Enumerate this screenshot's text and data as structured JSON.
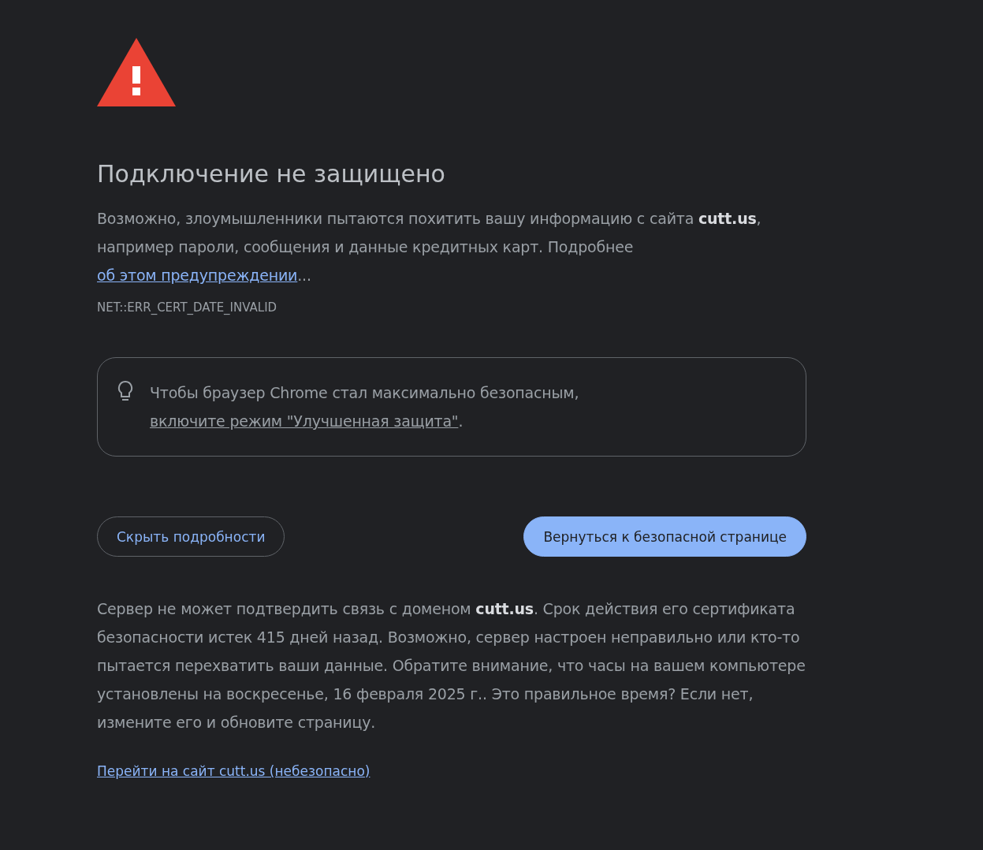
{
  "heading": "Подключение не защищено",
  "intro": {
    "text": "Возможно, злоумышленники пытаются похитить вашу информацию с сайта **cutt.us**, например пароли, сообщения и данные кредитных карт. Подробнее ",
    "link": "об этом предупреждении",
    "suffix": "..."
  },
  "error_code": "NET::ERR_CERT_DATE_INVALID",
  "tip": {
    "text": "Чтобы браузер Chrome стал максимально безопасным, ",
    "link": "включите режим \"Улучшенная защита\"",
    "suffix": "."
  },
  "buttons": [
    {
      "label": "Скрыть подробности",
      "kind": "outline"
    },
    {
      "label": "Вернуться к безопасной странице",
      "kind": "primary"
    }
  ],
  "details": "Сервер не может подтвердить связь с доменом **cutt.us**. Срок действия его сертификата безопасности истек 415 дней назад. Возможно, сервер настроен неправильно или кто-то пытается перехватить ваши данные. Обратите внимание, что часы на вашем компьютере установлены на воскресенье, 16 февраля 2025 г.. Это правильное время? Если нет, измените его и обновите страницу.",
  "proceed_link": "Перейти на сайт cutt.us (небезопасно)"
}
